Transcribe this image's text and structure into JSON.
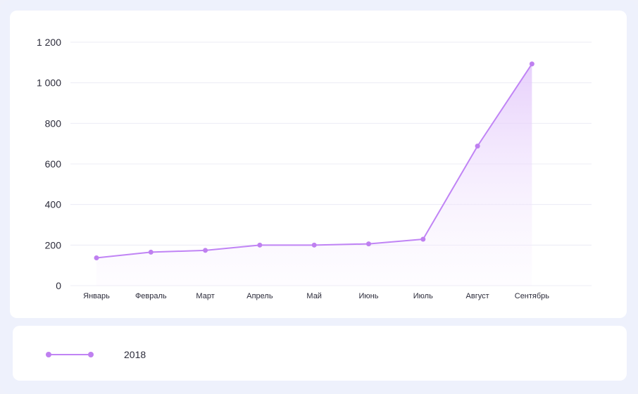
{
  "chart_data": {
    "type": "area",
    "categories": [
      "Январь",
      "Февраль",
      "Март",
      "Апрель",
      "Май",
      "Июнь",
      "Июль",
      "Август",
      "Сентябрь"
    ],
    "series": [
      {
        "name": "2018",
        "values": [
          137,
          165,
          174,
          200,
          200,
          206,
          229,
          688,
          1093
        ]
      }
    ],
    "ylim": [
      0,
      1200
    ],
    "yticks": [
      0,
      200,
      400,
      600,
      800,
      1000,
      1200
    ],
    "ytick_labels": [
      "0",
      "200",
      "400",
      "600",
      "800",
      "1 000",
      "1 200"
    ],
    "grid": true,
    "legend_position": "bottom-left",
    "colors": {
      "line": "#c084f5",
      "point": "#bf80f0",
      "fill": "#e7d2fb",
      "grid": "#ececf4"
    }
  },
  "legend": {
    "label": "2018"
  }
}
